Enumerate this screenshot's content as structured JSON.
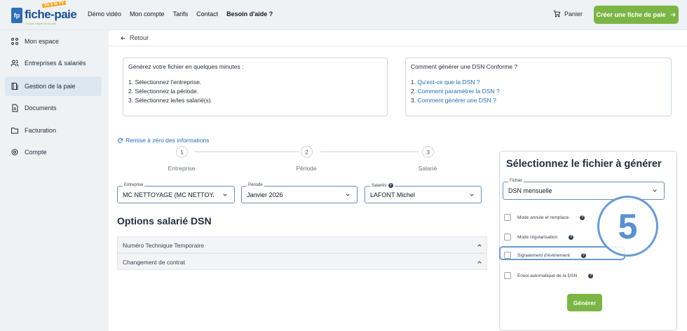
{
  "header": {
    "logo_word": "fiche-paie",
    "logo_ribbon": "Vu à la TV",
    "logo_tag": "Le plus simple de la paie",
    "nav": [
      "Démo vidéo",
      "Mon compte",
      "Tarifs",
      "Contact",
      "Besoin d'aide ?"
    ],
    "cart_label": "Panier",
    "cta_label": "Créer une fiche de paie",
    "accent_color": "#7bb545"
  },
  "sidebar": {
    "items": [
      {
        "label": "Mon espace",
        "icon": "grid-icon"
      },
      {
        "label": "Entreprises & salariés",
        "icon": "users-icon"
      },
      {
        "label": "Gestion de la paie",
        "icon": "payroll-icon",
        "active": true
      },
      {
        "label": "Documents",
        "icon": "document-icon"
      },
      {
        "label": "Facturation",
        "icon": "folder-icon"
      },
      {
        "label": "Compte",
        "icon": "gear-icon"
      }
    ]
  },
  "main": {
    "back_label": "Retour",
    "info_left": {
      "title": "Générez votre fichier en quelques minutes :",
      "lines": [
        "1. Sélectionnez l'entreprise.",
        "2. Sélectionnez la période.",
        "3. Sélectionnez le/les salarié(s)."
      ]
    },
    "info_right": {
      "title": "Comment générer une DSN Conforme ?",
      "links": [
        {
          "num": "1.",
          "label": "Qu'est-ce que la DSN ?"
        },
        {
          "num": "2.",
          "label": "Comment paramétrer la DSN ?"
        },
        {
          "num": "3.",
          "label": "Comment générer une DSN ?"
        }
      ]
    },
    "reset_label": "Remise à zéro des informations",
    "steps": [
      {
        "num": "1",
        "label": "Entreprise"
      },
      {
        "num": "2",
        "label": "Période"
      },
      {
        "num": "3",
        "label": "Salarié"
      }
    ],
    "fields": {
      "entreprise": {
        "label": "Entreprise",
        "value": "MC NETTOYAGE (MC NETTOYA..."
      },
      "periode": {
        "label": "Période",
        "value": "Janvier 2026"
      },
      "salaries": {
        "label": "Salariés",
        "value": "LAFONT Michel"
      }
    },
    "options_title": "Options salarié DSN",
    "accordions": [
      "Numéro Technique Temporaire",
      "Changement de contrat"
    ]
  },
  "panel": {
    "title": "Sélectionnez le fichier à générer",
    "file_label": "Fichier",
    "file_value": "DSN mensuelle",
    "checkboxes": [
      {
        "label": "Mode annule et remplace",
        "checked": false
      },
      {
        "label": "Mode régularisation",
        "checked": false
      },
      {
        "label": "Signalement d'événement",
        "checked": false
      },
      {
        "label": "Envoi automatique de la DSN",
        "checked": false
      }
    ],
    "generate_label": "Générer"
  },
  "annotation": {
    "step_number": "5",
    "color": "#6b9bd1"
  }
}
